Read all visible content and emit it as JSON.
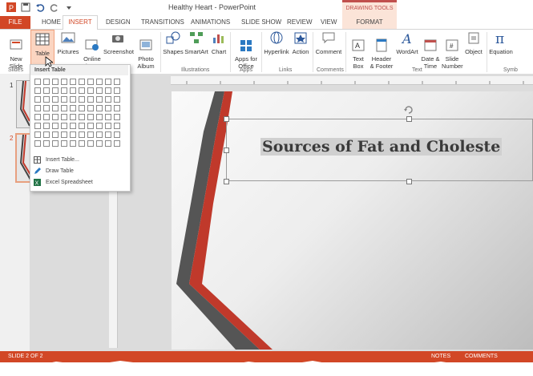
{
  "window": {
    "title": "Healthy Heart - PowerPoint",
    "context_tab_group": "DRAWING TOOLS"
  },
  "tabs": [
    "FILE",
    "HOME",
    "INSERT",
    "DESIGN",
    "TRANSITIONS",
    "ANIMATIONS",
    "SLIDE SHOW",
    "REVIEW",
    "VIEW",
    "FORMAT"
  ],
  "ribbon": {
    "buttons": {
      "new_slide": "New\nSlide",
      "table": "Table",
      "pictures": "Pictures",
      "online_pictures": "Online\nPictures",
      "screenshot": "Screenshot",
      "photo_album": "Photo\nAlbum",
      "shapes": "Shapes",
      "smartart": "SmartArt",
      "chart": "Chart",
      "apps_for_office": "Apps for\nOffice",
      "hyperlink": "Hyperlink",
      "action": "Action",
      "comment": "Comment",
      "text_box": "Text\nBox",
      "header_footer": "Header\n& Footer",
      "wordart": "WordArt",
      "date_time": "Date &\nTime",
      "slide_number": "Slide\nNumber",
      "object": "Object",
      "equation": "Equation"
    },
    "groups": {
      "slides": "Slides",
      "illustrations": "Illustrations",
      "apps": "Apps",
      "links": "Links",
      "comments": "Comments",
      "text": "Text",
      "symbols": "Symb"
    }
  },
  "table_dropdown": {
    "header": "Insert Table",
    "grid": {
      "columns": 10,
      "rows": 8
    },
    "items": [
      "Insert Table...",
      "Draw Table",
      "Excel Spreadsheet"
    ]
  },
  "slide_pane": {
    "numbers": [
      "1",
      "2"
    ]
  },
  "slide": {
    "title": "Sources of Fat and Choleste"
  },
  "status": {
    "left": "SLIDE 2 OF 2",
    "notes": "NOTES",
    "comments": "COMMENTS"
  },
  "colors": {
    "accent": "#d24726",
    "stripe_red": "#c0392b",
    "stripe_dark": "#4a4a4a"
  }
}
